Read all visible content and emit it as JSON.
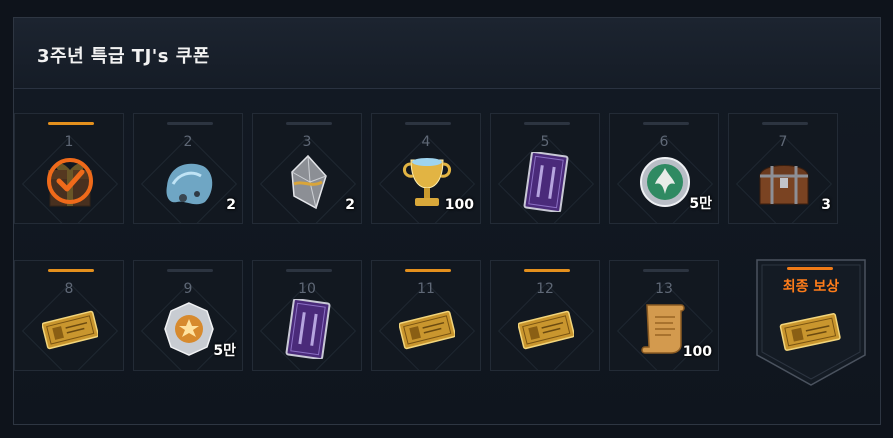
{
  "panel": {
    "title": "3주년 특급 TJ's 쿠폰"
  },
  "rewards": [
    {
      "index": "1",
      "icon": "gift-box-icon",
      "qty": "",
      "claimed": true,
      "bar_active": true
    },
    {
      "index": "2",
      "icon": "blue-cloth-icon",
      "qty": "2",
      "claimed": false,
      "bar_active": false
    },
    {
      "index": "3",
      "icon": "silver-crystal-icon",
      "qty": "2",
      "claimed": false,
      "bar_active": false
    },
    {
      "index": "4",
      "icon": "golden-trophy-icon",
      "qty": "100",
      "claimed": false,
      "bar_active": false
    },
    {
      "index": "5",
      "icon": "purple-card-icon",
      "qty": "",
      "claimed": false,
      "bar_active": false
    },
    {
      "index": "6",
      "icon": "silver-coin-icon",
      "qty": "5만",
      "claimed": false,
      "bar_active": false
    },
    {
      "index": "7",
      "icon": "treasure-chest-icon",
      "qty": "3",
      "claimed": false,
      "bar_active": false
    },
    {
      "index": "8",
      "icon": "gold-ticket-icon",
      "qty": "",
      "claimed": false,
      "bar_active": true
    },
    {
      "index": "9",
      "icon": "star-medal-icon",
      "qty": "5만",
      "claimed": false,
      "bar_active": false
    },
    {
      "index": "10",
      "icon": "purple-card-icon",
      "qty": "",
      "claimed": false,
      "bar_active": false
    },
    {
      "index": "11",
      "icon": "gold-ticket-icon",
      "qty": "",
      "claimed": false,
      "bar_active": true
    },
    {
      "index": "12",
      "icon": "gold-ticket-icon",
      "qty": "",
      "claimed": false,
      "bar_active": true
    },
    {
      "index": "13",
      "icon": "scroll-icon",
      "qty": "100",
      "claimed": false,
      "bar_active": false
    }
  ],
  "final_reward": {
    "label": "최종 보상",
    "icon": "gold-ticket-icon"
  },
  "colors": {
    "accent": "#e4901d",
    "final": "#ff7d1a",
    "check": "#ef6a1a"
  }
}
